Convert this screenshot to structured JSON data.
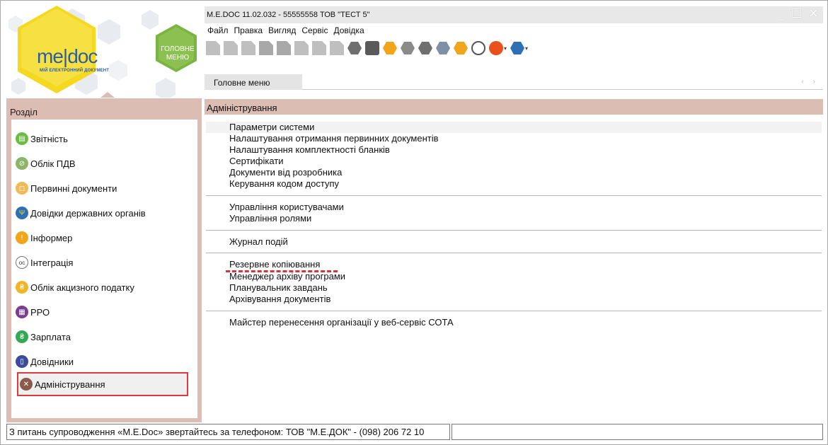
{
  "window": {
    "title": "M.E.DOC 11.02.032  - 55555558 ТОВ \"ТЕСТ 5\"",
    "controls": {
      "minimize": "_",
      "maximize": "☐",
      "close": "✕"
    }
  },
  "logo": {
    "text_me": "me",
    "text_doc": "doc",
    "subtitle": "МІЙ ЕЛЕКТРОННИЙ ДОКУМЕНТ",
    "main_menu_button": "ГОЛОВНЕ МЕНЮ",
    "colors": {
      "yellow": "#f5d820",
      "green": "#7ab541",
      "gray_hex": "#e5e9ee"
    }
  },
  "menubar": {
    "items": [
      "Файл",
      "Правка",
      "Вигляд",
      "Сервіс",
      "Довідка"
    ]
  },
  "toolbar": {
    "icons": [
      "new-document-icon",
      "open-document-icon",
      "delete-document-icon",
      "copy-document-icon",
      "edit-document-icon",
      "add-document-icon",
      "find-document-icon",
      "remove-document-icon",
      "archive-icon",
      "print-icon",
      "send-envelope-icon",
      "settings-gear-icon",
      "inbox-icon",
      "check-badge-icon",
      "help-icon",
      "comment-icon",
      "chat-bubble-icon",
      "users-help-icon"
    ]
  },
  "tabs": {
    "active": "Головне меню",
    "scroll_arrows": "‹ ›"
  },
  "sidebar": {
    "title": "Розділ",
    "items": [
      {
        "label": "Звітність",
        "icon": "reports-icon",
        "color": "#6dbb45"
      },
      {
        "label": "Облік ПДВ",
        "icon": "vat-icon",
        "color": "#8db56a"
      },
      {
        "label": "Первинні документи",
        "icon": "primary-docs-icon",
        "color": "#f2b955"
      },
      {
        "label": "Довідки державних органів",
        "icon": "gov-references-icon",
        "color": "#2e6fb5"
      },
      {
        "label": "Інформер",
        "icon": "informer-icon",
        "color": "#f0a51b"
      },
      {
        "label": "Інтеграція",
        "icon": "integration-icon",
        "color": "#ffffff"
      },
      {
        "label": "Облік акцизного податку",
        "icon": "excise-icon",
        "color": "#f0b62a"
      },
      {
        "label": "РРО",
        "icon": "cash-register-icon",
        "color": "#7a3d8f"
      },
      {
        "label": "Зарплата",
        "icon": "salary-icon",
        "color": "#34a853"
      },
      {
        "label": "Довідники",
        "icon": "directories-icon",
        "color": "#3b4c9a"
      },
      {
        "label": "Адміністрування",
        "icon": "administration-icon",
        "color": "#8b5a4a"
      }
    ],
    "selected_index": 10
  },
  "main": {
    "section_title": "Адміністрування",
    "groups": [
      [
        "Параметри системи",
        "Налаштування отримання первинних документів",
        "Налаштування комплектності бланків",
        "Сертифікати",
        "Документи від розробника",
        "Керування кодом доступу"
      ],
      [
        "Управління користувачами",
        "Управління ролями"
      ],
      [
        "Журнал подій"
      ],
      [
        "Резервне копіювання",
        "Менеджер архіву програми",
        "Планувальник завдань",
        "Архівування документів"
      ],
      [
        "Майстер перенесення організації у веб-сервіс СОТА"
      ]
    ],
    "highlight_color": "#d6333a"
  },
  "status": {
    "text": "З питань супроводження «M.E.Doc» звертайтесь за телефоном: ТОВ \"М.Е.ДОК\" - (098) 206 72 10",
    "right": ""
  }
}
